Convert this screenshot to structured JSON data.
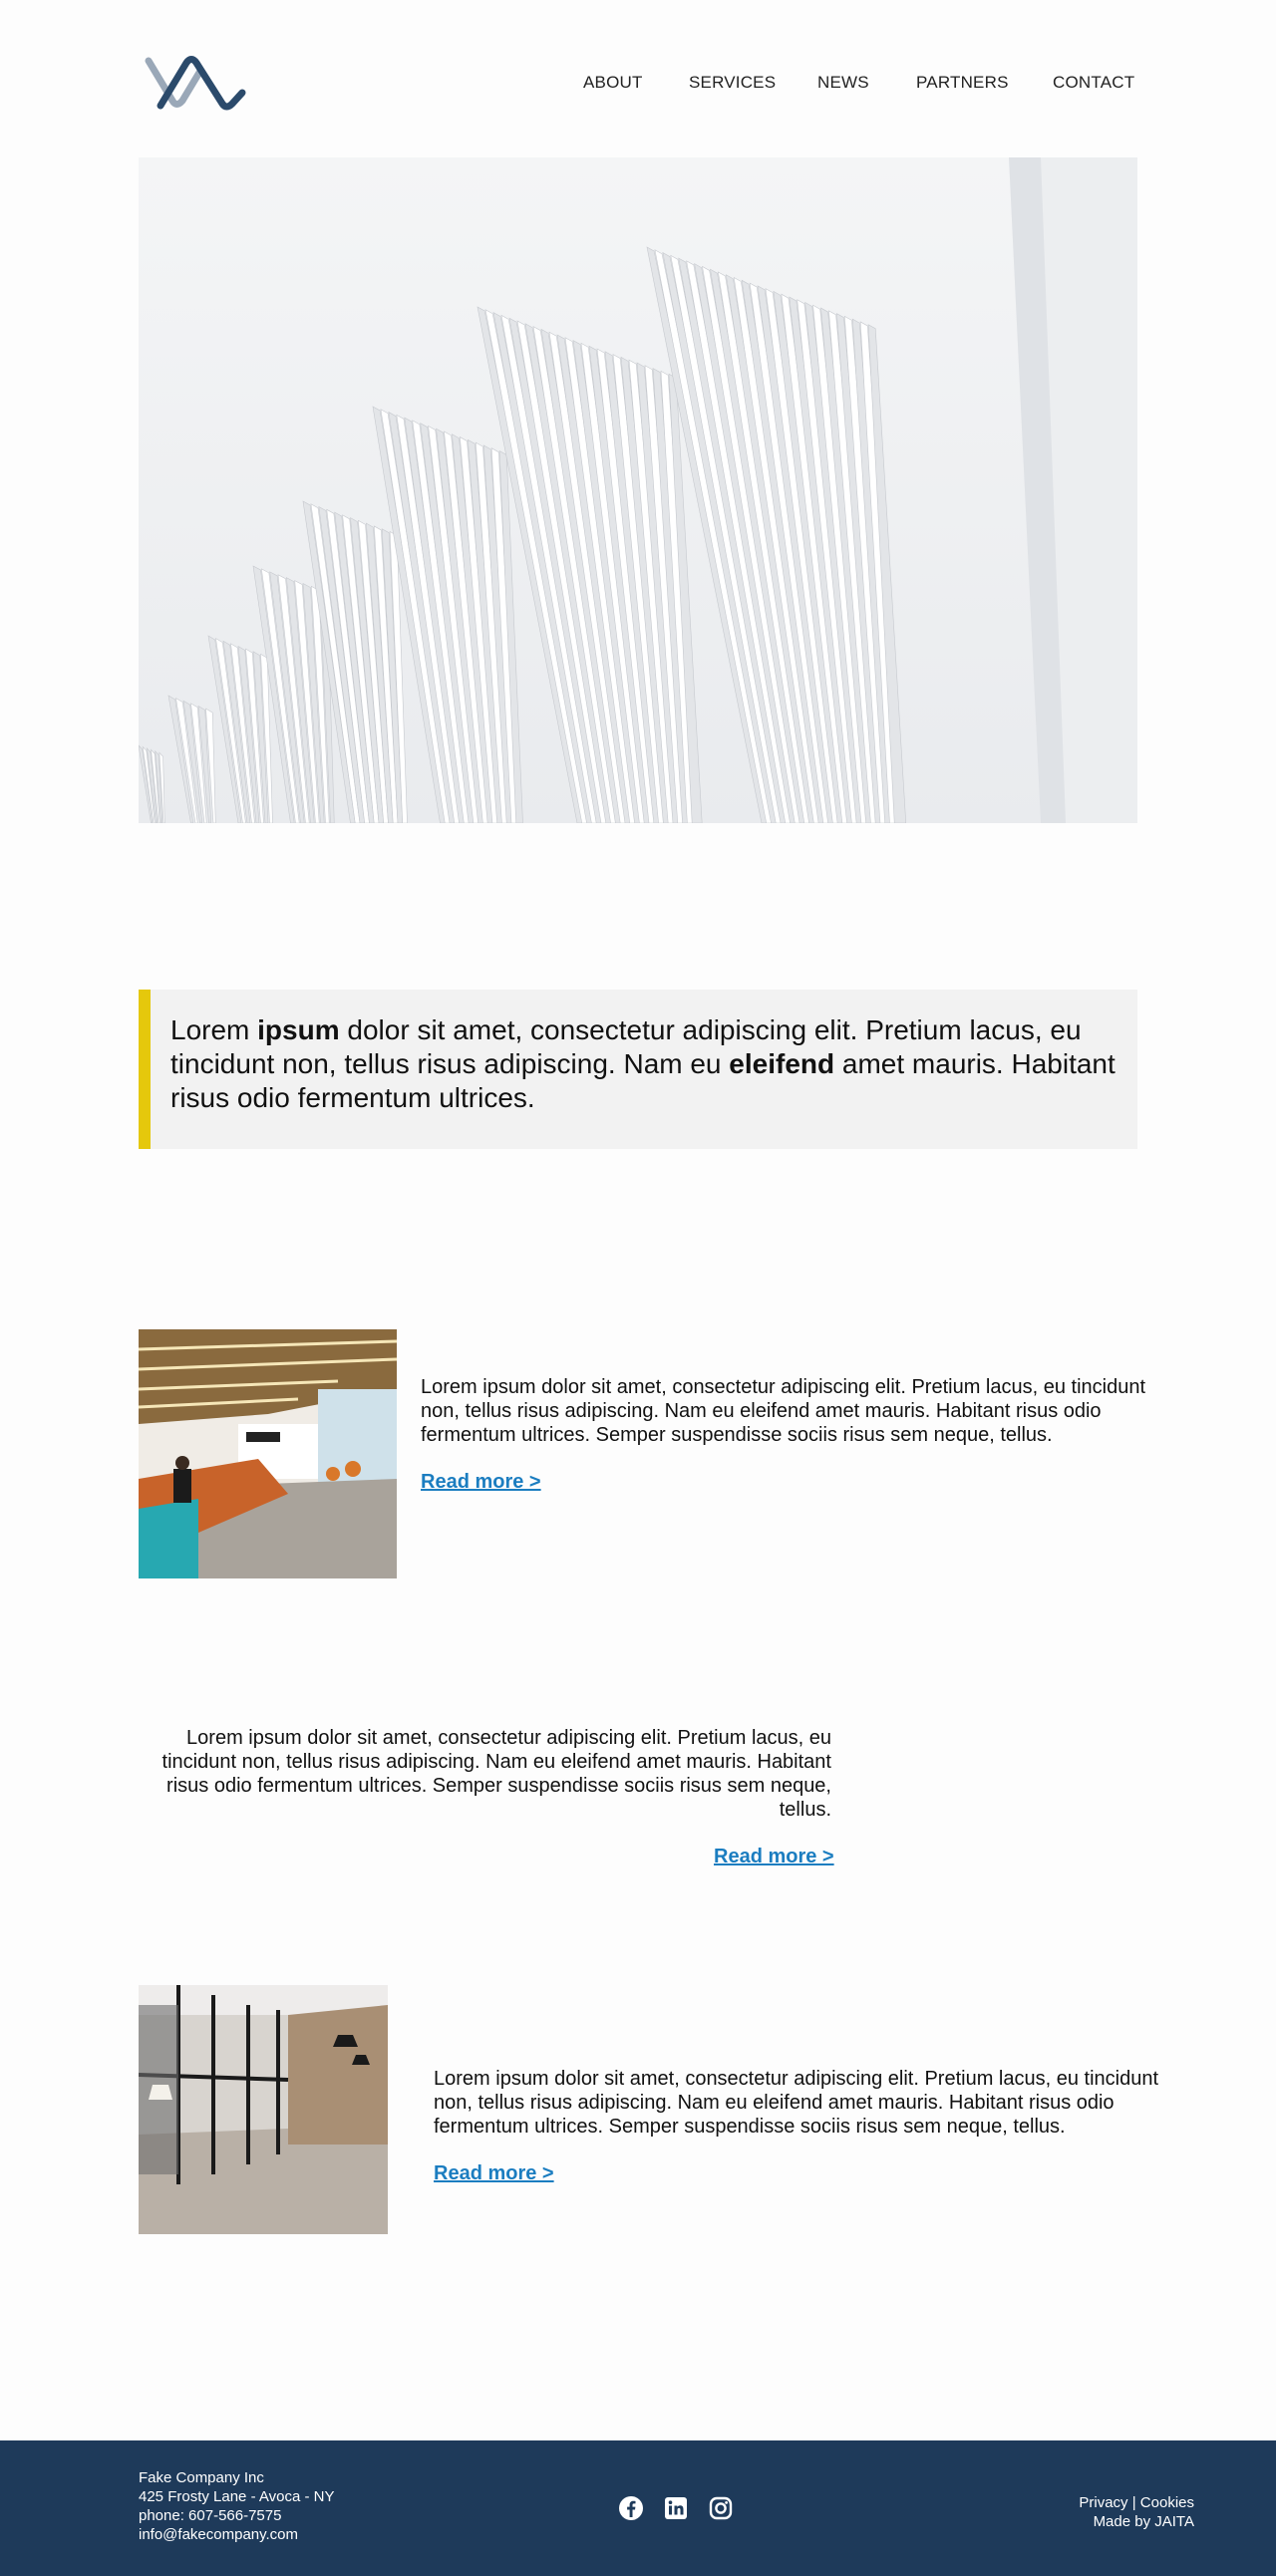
{
  "header": {
    "logo_icon": "company-logo",
    "nav": [
      "ABOUT",
      "SERVICES",
      "NEWS",
      "PARTNERS",
      "CONTACT"
    ]
  },
  "hero": {
    "image": "white-architecture-fins"
  },
  "quote": {
    "t1": "Lorem ",
    "b1": "ipsum",
    "t2": " dolor sit amet, consectetur adipiscing elit. Pretium lacus, eu tincidunt non, tellus risus adipiscing. Nam eu ",
    "b2": "eleifend",
    "t3": " amet mauris. Habitant risus odio fermentum ultrices.",
    "accent_color": "#e5c80c"
  },
  "articles": [
    {
      "image": "office-lobby-photo",
      "text": "Lorem ipsum dolor sit amet, consectetur adipiscing elit. Pretium lacus, eu tincidunt non, tellus risus adipiscing. Nam eu eleifend amet mauris. Habitant risus odio fermentum ultrices. Semper suspendisse sociis risus sem neque, tellus.",
      "link": "Read more >"
    },
    {
      "text": "Lorem ipsum dolor sit amet, consectetur adipiscing elit. Pretium lacus, eu tincidunt non, tellus risus adipiscing. Nam eu eleifend amet mauris. Habitant risus odio fermentum ultrices. Semper suspendisse sociis risus sem neque, tellus.",
      "link": "Read more >"
    },
    {
      "image": "glass-office-corridor-photo",
      "text": "Lorem ipsum dolor sit amet, consectetur adipiscing elit. Pretium lacus, eu tincidunt non, tellus risus adipiscing. Nam eu eleifend amet mauris. Habitant risus odio fermentum ultrices. Semper suspendisse sociis risus sem neque, tellus.",
      "link": "Read more >"
    }
  ],
  "footer": {
    "company": "Fake Company Inc",
    "address": "425 Frosty Lane - Avoca - NY",
    "phone": "phone: 607-566-7575",
    "email": "info@fakecompany.com",
    "social": [
      "facebook-icon",
      "linkedin-icon",
      "instagram-icon"
    ],
    "privacy": "Privacy",
    "separator": " | ",
    "cookies": "Cookies",
    "made_by": "Made by JAITA",
    "background": "#1e3a5a",
    "link_color": "#1b7dc0"
  }
}
